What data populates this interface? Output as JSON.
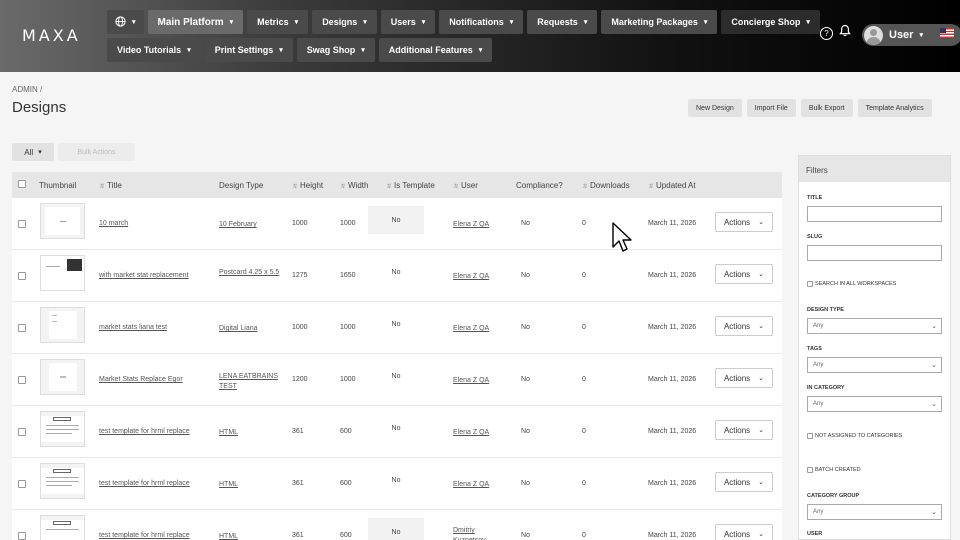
{
  "brand": "MAXA",
  "nav": {
    "row1": [
      {
        "label": "Main Platform"
      },
      {
        "label": "Metrics"
      },
      {
        "label": "Designs"
      },
      {
        "label": "Users"
      },
      {
        "label": "Notifications"
      },
      {
        "label": "Requests"
      },
      {
        "label": "Marketing Packages"
      },
      {
        "label": "Concierge Shop"
      }
    ],
    "row2": [
      {
        "label": "Video Tutorials"
      },
      {
        "label": "Print Settings"
      },
      {
        "label": "Swag Shop"
      },
      {
        "label": "Additional Features"
      }
    ],
    "user_label": "User"
  },
  "breadcrumb": "ADMIN /",
  "page_title": "Designs",
  "toolbar": {
    "new_design": "New Design",
    "import_file": "Import File",
    "bulk_export": "Bulk Export",
    "template_analytics": "Template Analytics"
  },
  "filter_bar": {
    "all": "All",
    "bulk_actions": "Bulk Actions"
  },
  "table": {
    "headers": {
      "thumbnail": "Thumbnail",
      "title": "Title",
      "design_type": "Design Type",
      "height": "Height",
      "width": "Width",
      "is_template": "Is Template",
      "user": "User",
      "compliance": "Compliance?",
      "downloads": "Downloads",
      "updated_at": "Updated At"
    },
    "actions_label": "Actions",
    "rows": [
      {
        "title": "10 march",
        "design_type": "10 February",
        "height": "1000",
        "width": "1000",
        "is_template": "No",
        "user": "Elena Z QA",
        "compliance": "No",
        "downloads": "0",
        "updated_at": "March 11, 2026"
      },
      {
        "title": "with market stat replacement",
        "design_type": "Postcard 4.25 x 5.5",
        "height": "1275",
        "width": "1650",
        "is_template": "No",
        "user": "Elena Z QA",
        "compliance": "No",
        "downloads": "0",
        "updated_at": "March 11, 2026"
      },
      {
        "title": "market stats liana test",
        "design_type": "Digital Liana",
        "height": "1000",
        "width": "1000",
        "is_template": "No",
        "user": "Elena Z QA",
        "compliance": "No",
        "downloads": "0",
        "updated_at": "March 11, 2026"
      },
      {
        "title": "Market Stats Replace Egor",
        "design_type": "LENA EATBRAINS TEST",
        "height": "1200",
        "width": "1000",
        "is_template": "No",
        "user": "Elena Z QA",
        "compliance": "No",
        "downloads": "0",
        "updated_at": "March 11, 2026"
      },
      {
        "title": "test template for hrml replace",
        "design_type": "HTML",
        "height": "361",
        "width": "600",
        "is_template": "No",
        "user": "Elena Z QA",
        "compliance": "No",
        "downloads": "0",
        "updated_at": "March 11, 2026"
      },
      {
        "title": "test template for hrml replace",
        "design_type": "HTML",
        "height": "361",
        "width": "600",
        "is_template": "No",
        "user": "Elena Z QA",
        "compliance": "No",
        "downloads": "0",
        "updated_at": "March 11, 2026"
      },
      {
        "title": "test template for hrml replace",
        "design_type": "HTML",
        "height": "361",
        "width": "600",
        "is_template": "No",
        "user": "Dmitriy Kuznetsov",
        "compliance": "No",
        "downloads": "0",
        "updated_at": "March 11, 2026"
      }
    ]
  },
  "filters": {
    "heading": "Filters",
    "title_label": "TITLE",
    "slug_label": "SLUG",
    "search_all_workspaces": "SEARCH IN ALL WORKSPACES",
    "design_type_label": "DESIGN TYPE",
    "design_type_value": "Any",
    "tags_label": "TAGS",
    "tags_value": "Any",
    "in_category_label": "IN CATEGORY",
    "in_category_value": "Any",
    "not_assigned": "NOT ASSIGNED TO CATEGORIES",
    "batch_created": "BATCH CREATED",
    "category_group_label": "CATEGORY GROUP",
    "category_group_value": "Any",
    "user_label": "USER"
  }
}
